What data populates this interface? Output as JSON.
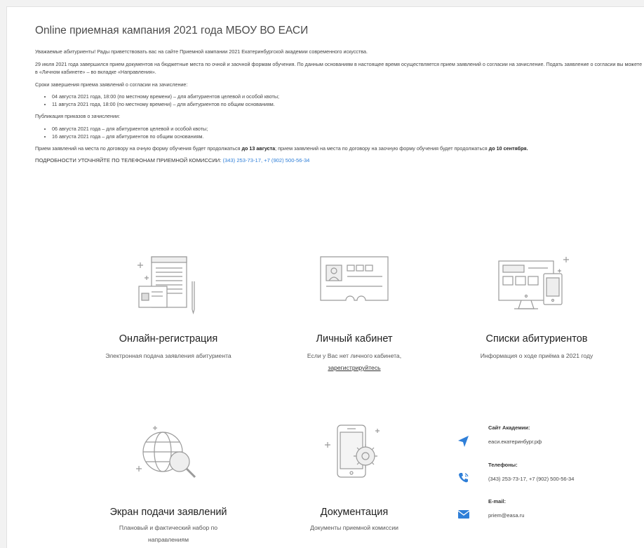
{
  "header": {
    "title": "Online приемная кампания 2021 года МБОУ ВО ЕАСИ"
  },
  "intro": {
    "welcome": "Уважаемые абитуриенты! Рады приветствовать вас на сайте Приемной кампании 2021 Екатеринбургской академии современного искусства.",
    "july_notice": "29 июля 2021 года завершился прием документов на бюджетные места по очной и заочной формам обучения. По данным основаниям в настоящее время осуществляется прием заявлений о согласии на зачисление. Подать заявление о согласии вы можете в «Личном кабинете» – во вкладке «Направления».",
    "deadlines_heading": "Сроки завершения приема заявлений о согласии на зачисление:",
    "deadlines": [
      "04 августа 2021 года, 18:00 (по местному времени) – для абитуриентов целевой и особой квоты;",
      "11 августа 2021 года, 18:00 (по местному времени) – для абитуриентов по общим основаниям."
    ],
    "orders_heading": "Публикация приказов о зачислении:",
    "orders": [
      "06 августа 2021 года – для абитуриентов целевой и особой квоты;",
      "16 августа 2021 года – для абитуриентов по общим основаниям."
    ],
    "contract_part1": "Прием заявлений на места по договору на очную форму обучения будет продолжаться ",
    "contract_bold1": "до 13 августа",
    "contract_part2": "; прием заявлений на места по договору на заочную форму обучения будет продолжаться ",
    "contract_bold2": "до 10 сентября.",
    "phones_prefix": "ПОДРОБНОСТИ УТОЧНЯЙТЕ ПО ТЕЛЕФОНАМ ПРИЕМНОЙ КОМИССИИ: ",
    "phones_link": "(343) 253-73-17, +7 (902) 500-56-34"
  },
  "cards": {
    "registration": {
      "title": "Онлайн-регистрация",
      "text": "Электронная подача заявления абитуриента"
    },
    "cabinet": {
      "title": "Личный кабинет",
      "text": "Если у Вас нет личного кабинета,",
      "link": "зарегистрируйтесь"
    },
    "lists": {
      "title": "Списки абитуриентов",
      "text": "Информация о ходе приёма в 2021 году"
    },
    "screen": {
      "title": "Экран подачи заявлений",
      "text": "Плановый и фактический набор по направлениям"
    },
    "docs": {
      "title": "Документация",
      "text": "Документы приемной комиссии"
    }
  },
  "contacts": {
    "site_label": "Сайт Академии:",
    "site_value": "еаси.екатеринбург.рф",
    "phones_label": "Телефоны:",
    "phones_value": "(343) 253-73-17, +7 (902) 500-56-34",
    "email_label": "E-mail:",
    "email_value": "priem@easa.ru"
  },
  "colors": {
    "accent": "#2f7fd8",
    "icon_line": "#9a9a9a"
  },
  "icons": [
    "document-form-icon",
    "id-card-icon",
    "computer-devices-icon",
    "globe-search-icon",
    "phone-gear-icon",
    "location-arrow-icon",
    "phone-icon",
    "email-icon"
  ]
}
